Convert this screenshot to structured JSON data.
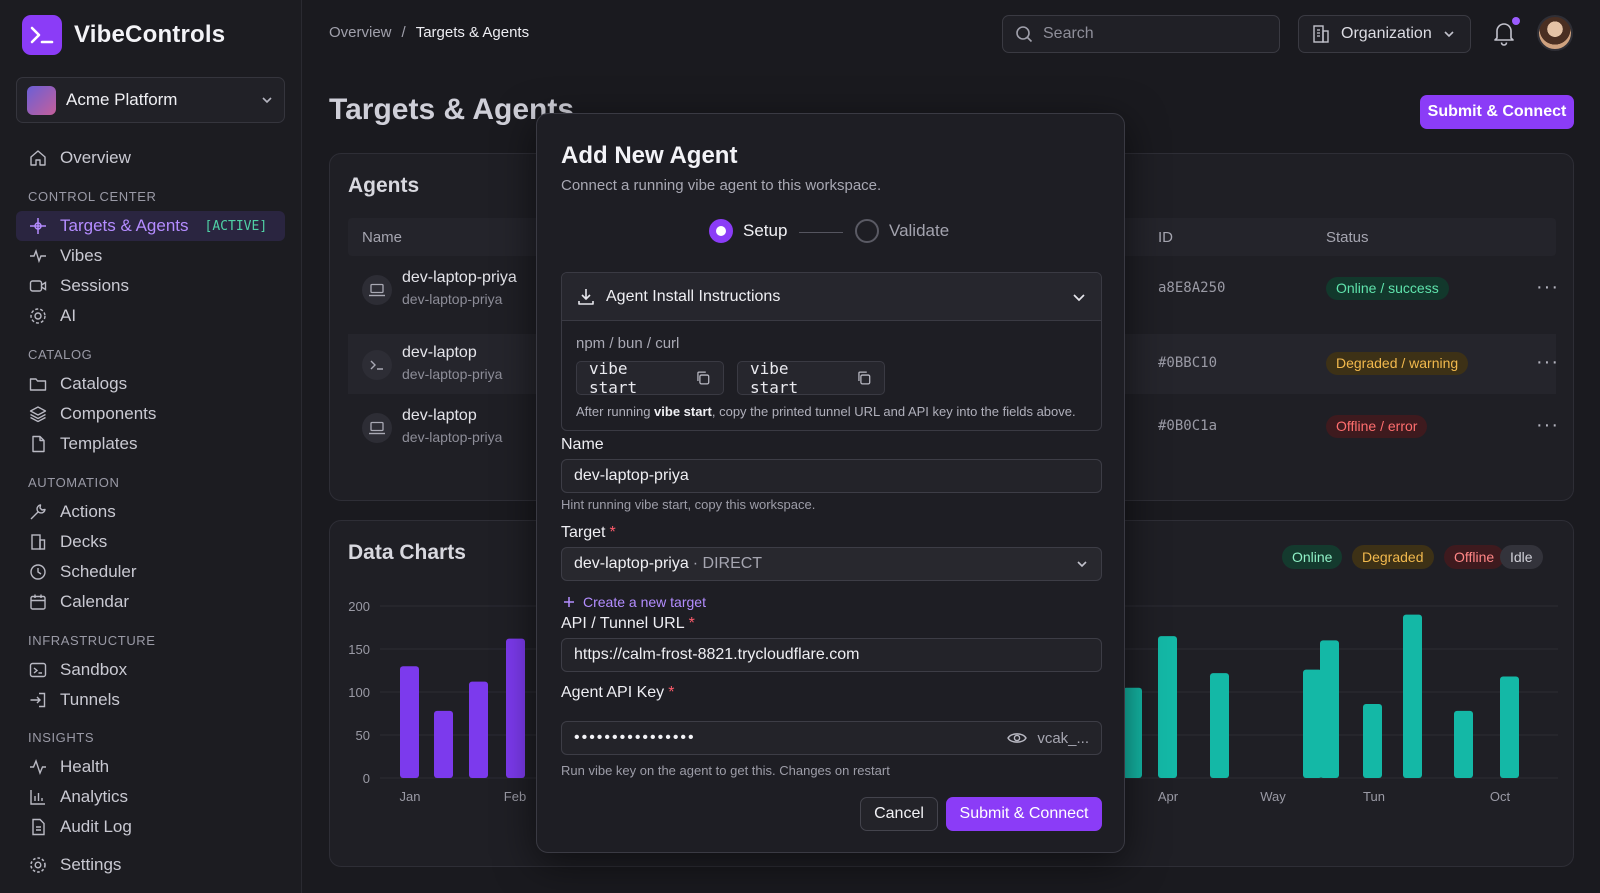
{
  "app": {
    "name": "VibeControls",
    "workspace": "Acme Platform"
  },
  "sidebar": {
    "overview": "Overview",
    "sections": [
      {
        "title": "CONTROL CENTER",
        "items": [
          "Targets & Agents",
          "Vibes",
          "Sessions",
          "AI"
        ]
      },
      {
        "title": "CATALOG",
        "items": [
          "Catalogs",
          "Components",
          "Templates"
        ]
      },
      {
        "title": "AUTOMATION",
        "items": [
          "Actions",
          "Decks",
          "Scheduler",
          "Calendar"
        ]
      },
      {
        "title": "INFRASTRUCTURE",
        "items": [
          "Sandbox",
          "Tunnels"
        ]
      },
      {
        "title": "INSIGHTS",
        "items": [
          "Health",
          "Analytics",
          "Audit Log"
        ]
      }
    ],
    "active_badge": "[ACTIVE]",
    "settings": "Settings"
  },
  "header": {
    "breadcrumb": [
      "Overview",
      "/",
      "Targets & Agents"
    ],
    "search_placeholder": "Search",
    "org_label": "Organization",
    "page_title": "Targets & Agents",
    "submit_label": "Submit & Connect"
  },
  "agents": {
    "title": "Agents",
    "columns": [
      "Name",
      "ID",
      "Status"
    ],
    "rows": [
      {
        "name": "dev-laptop-priya",
        "sub": "dev-laptop-priya",
        "id": "a8E8A250",
        "status": "Online / success",
        "kind": "ok",
        "icon": "laptop-icon"
      },
      {
        "name": "dev-laptop",
        "sub": "dev-laptop-priya",
        "id": "#0BBC10",
        "status": "Degraded / warning",
        "kind": "warn",
        "icon": "terminal-icon"
      },
      {
        "name": "dev-laptop",
        "sub": "dev-laptop-priya",
        "id": "#0B0C1a",
        "status": "Offline / error",
        "kind": "err",
        "icon": "laptop-icon"
      }
    ],
    "more": "···"
  },
  "charts": {
    "title": "Data Charts",
    "legend": [
      "Online",
      "Degraded",
      "Offline",
      "Idle"
    ]
  },
  "chart_data": {
    "type": "bar",
    "ylim": [
      0,
      200
    ],
    "yticks": [
      0,
      50,
      100,
      150,
      200
    ],
    "grid": true,
    "legend_position": "top-right",
    "visible_x_labels": [
      "Jan",
      "Feb",
      "Apr",
      "Way",
      "Tun",
      "Oct"
    ],
    "series": [
      {
        "color": "#7c3aed",
        "values": [
          130,
          78,
          112,
          162
        ]
      },
      {
        "color": "#14b8a6",
        "values": [
          105,
          165,
          122,
          126,
          160,
          86,
          190,
          78,
          118
        ]
      }
    ]
  },
  "modal": {
    "title": "Add New Agent",
    "subtitle": "Connect a running vibe agent to this workspace.",
    "steps": [
      "Setup",
      "Validate"
    ],
    "accordion": {
      "title": "Agent Install Instructions",
      "label": "npm / bun / curl",
      "commands": [
        "vibe start",
        "vibe start"
      ],
      "note_pre": "After running ",
      "note_bold": "vibe start",
      "note_post": ", copy the printed tunnel URL and API key into the fields above."
    },
    "name_label": "Name",
    "name_value": "dev-laptop-priya",
    "name_hint": "Hint running vibe start, copy this workspace.",
    "target_label": "Target",
    "target_value": "dev-laptop-priya",
    "target_mode": "· DIRECT",
    "create_target": "Create a new target",
    "url_label": "API / Tunnel URL",
    "url_value": "https://calm-frost-8821.trycloudflare.com",
    "key_label": "Agent API Key",
    "key_value": "••••••••••••••••",
    "key_prefix": "vcak_...",
    "key_hint": "Run vibe key on the agent to get this. Changes on restart",
    "required_mark": "*",
    "cancel": "Cancel",
    "submit": "Submit & Connect"
  },
  "colors": {
    "accent": "#8b3cf7",
    "online": "#5fe3ac",
    "warning": "#f2b94d",
    "error": "#ff6e6e",
    "teal": "#14b8a6"
  }
}
